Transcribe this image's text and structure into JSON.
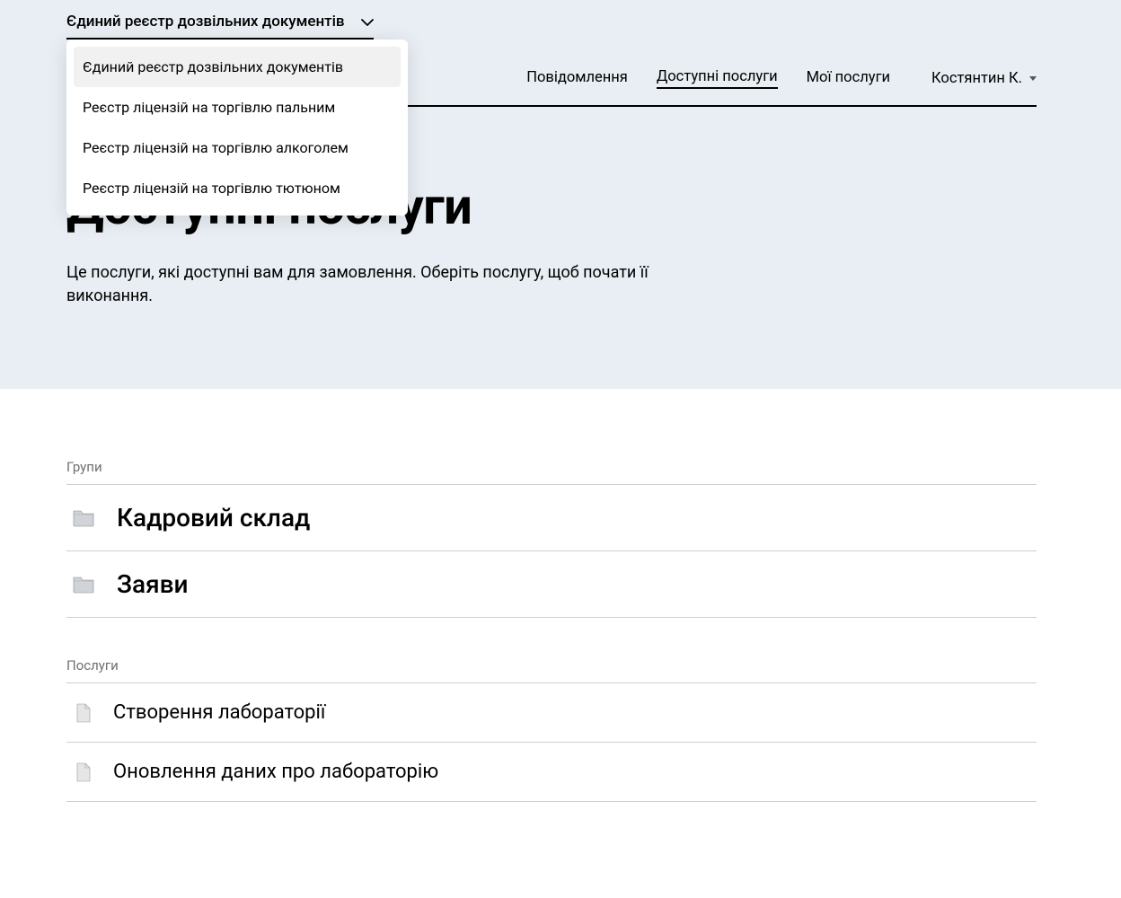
{
  "registry": {
    "selected": "Єдиний реєстр дозвільних документів",
    "options": [
      "Єдиний реєстр дозвільних документів",
      "Реєстр ліцензій на торгівлю пальним",
      "Реєстр ліцензій на торгівлю алкоголем",
      "Реєстр ліцензій на торгівлю тютюном"
    ]
  },
  "nav": {
    "notifications": "Повідомлення",
    "available": "Доступні послуги",
    "my": "Мої послуги"
  },
  "user": {
    "name": "Костянтин К."
  },
  "hero": {
    "title": "Доступні послуги",
    "description": "Це послуги, які доступні вам для замовлення. Оберіть послугу, щоб почати її виконання."
  },
  "groups": {
    "label": "Групи",
    "items": [
      "Кадровий склад",
      "Заяви"
    ]
  },
  "services": {
    "label": "Послуги",
    "items": [
      "Створення лабораторії",
      "Оновлення даних про лабораторію"
    ]
  }
}
